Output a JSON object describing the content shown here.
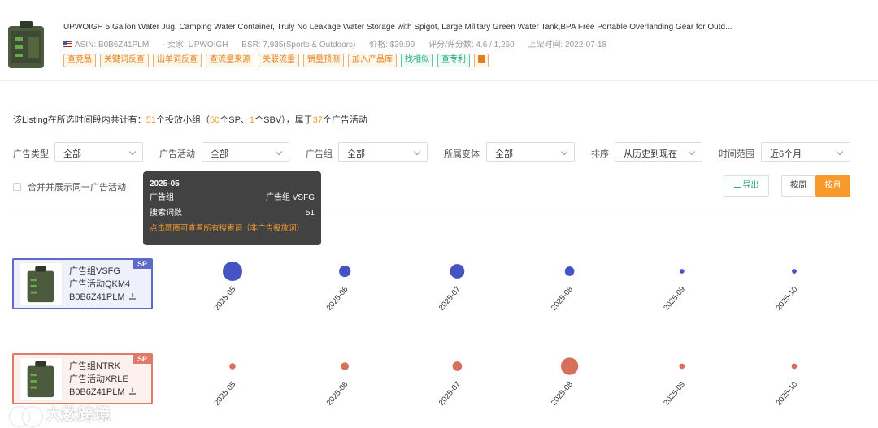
{
  "product": {
    "title": "UPWOIGH 5 Gallon Water Jug, Camping Water Container, Truly No Leakage Water Storage with Spigot, Large Military Green Water Tank,BPA Free Portable Overlanding Gear for Outd...",
    "asin": "ASIN: B0B6Z41PLM",
    "seller": "- 卖家: UPWOIGH",
    "bsr": "BSR: 7,935(Sports & Outdoors)",
    "price": "价格: $39.99",
    "rating": "评分/评分数: 4.6 / 1,260",
    "listed": "上架时间: 2022-07-18",
    "tags_orange": [
      "查竞品",
      "关键词反查",
      "出单词反查",
      "查流量来源",
      "关联流量",
      "销量预测",
      "加入产品库"
    ],
    "tags_green": [
      "找相似",
      "查专利"
    ]
  },
  "summary": {
    "prefix": "该Listing在所选时间段内共计有：",
    "groups": "51",
    "t1": "个投放小组（",
    "sp": "50",
    "t2": "个SP、",
    "sbv": "1",
    "t3": "个SBV），属于",
    "campaigns": "37",
    "t4": "个广告活动"
  },
  "filters": {
    "ad_type_label": "广告类型",
    "ad_type_value": "全部",
    "campaign_label": "广告活动",
    "campaign_value": "全部",
    "group_label": "广告组",
    "group_value": "全部",
    "variant_label": "所属变体",
    "variant_value": "全部",
    "sort_label": "排序",
    "sort_value": "从历史到现在",
    "range_label": "时间范围",
    "range_value": "近6个月"
  },
  "merge_label": "合并并展示同一广告活动",
  "export_label": "导出",
  "period": {
    "week": "按周",
    "month": "按月"
  },
  "tooltip": {
    "title": "2025-05",
    "row1_label": "广告组",
    "row1_value": "广告组 VSFG",
    "row2_label": "搜索词数",
    "row2_value": "51",
    "hint": "点击圆圈可查看所有搜索词（非广告投放词）"
  },
  "groups": [
    {
      "name": "广告组VSFG",
      "campaign": "广告活动QKM4",
      "asin": "B0B6Z41PLM",
      "badge": "SP",
      "color": "#4653c2"
    },
    {
      "name": "广告组NTRK",
      "campaign": "广告活动XRLE",
      "asin": "B0B6Z41PLM",
      "badge": "SP",
      "color": "#d6705c"
    }
  ],
  "chart_data": {
    "type": "scatter",
    "categories": [
      "2025-05",
      "2025-06",
      "2025-07",
      "2025-08",
      "2025-09",
      "2025-10"
    ],
    "series": [
      {
        "name": "广告组VSFG",
        "values": [
          51,
          18,
          28,
          12,
          3,
          3
        ]
      },
      {
        "name": "广告组NTRK",
        "values": [
          5,
          8,
          12,
          40,
          4,
          4
        ]
      }
    ]
  },
  "watermark": "大数跨境"
}
